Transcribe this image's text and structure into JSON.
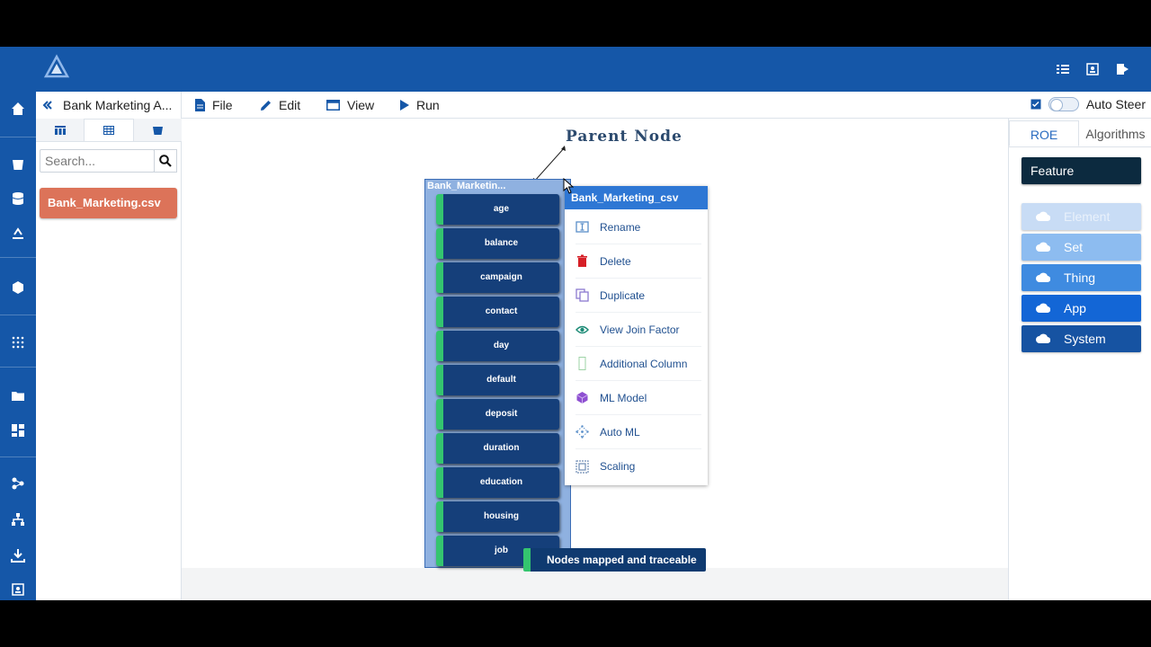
{
  "header": {
    "logo": "product-logo",
    "icons": [
      "list-icon",
      "user-badge-icon",
      "logout-icon"
    ]
  },
  "left_panel": {
    "title": "Bank Marketing A...",
    "search": {
      "placeholder": "Search...",
      "value": ""
    },
    "file_label": "Bank_Marketing.csv"
  },
  "toolbar": {
    "file": "File",
    "edit": "Edit",
    "view": "View",
    "run": "Run",
    "auto_steer": "Auto Steer"
  },
  "canvas": {
    "annotation": "Parent Node",
    "node_title": "Bank_Marketin...",
    "columns": [
      "age",
      "balance",
      "campaign",
      "contact",
      "day",
      "default",
      "deposit",
      "duration",
      "education",
      "housing",
      "job"
    ]
  },
  "context_menu": {
    "title": "Bank_Marketing_csv",
    "items": [
      "Rename",
      "Delete",
      "Duplicate",
      "View Join Factor",
      "Additional Column",
      "ML Model",
      "Auto ML",
      "Scaling"
    ]
  },
  "toast": "Nodes mapped and traceable",
  "right_panel": {
    "tabs": [
      "ROE",
      "Algorithms"
    ],
    "feature": "Feature",
    "levels": [
      {
        "label": "Element",
        "color": "#c8dcf5",
        "text_color": "#e9f1fb"
      },
      {
        "label": "Set",
        "color": "#8dbcf0",
        "text_color": "#ffffff"
      },
      {
        "label": "Thing",
        "color": "#3f8be0",
        "text_color": "#ffffff"
      },
      {
        "label": "App",
        "color": "#1366d6",
        "text_color": "#ffffff"
      },
      {
        "label": "System",
        "color": "#1653a2",
        "text_color": "#ffffff"
      }
    ]
  },
  "colors": {
    "brand_blue": "#1557a8",
    "node_fill": "#153f7a",
    "accent_green": "#34c56f",
    "file_orange": "#dc7359"
  }
}
